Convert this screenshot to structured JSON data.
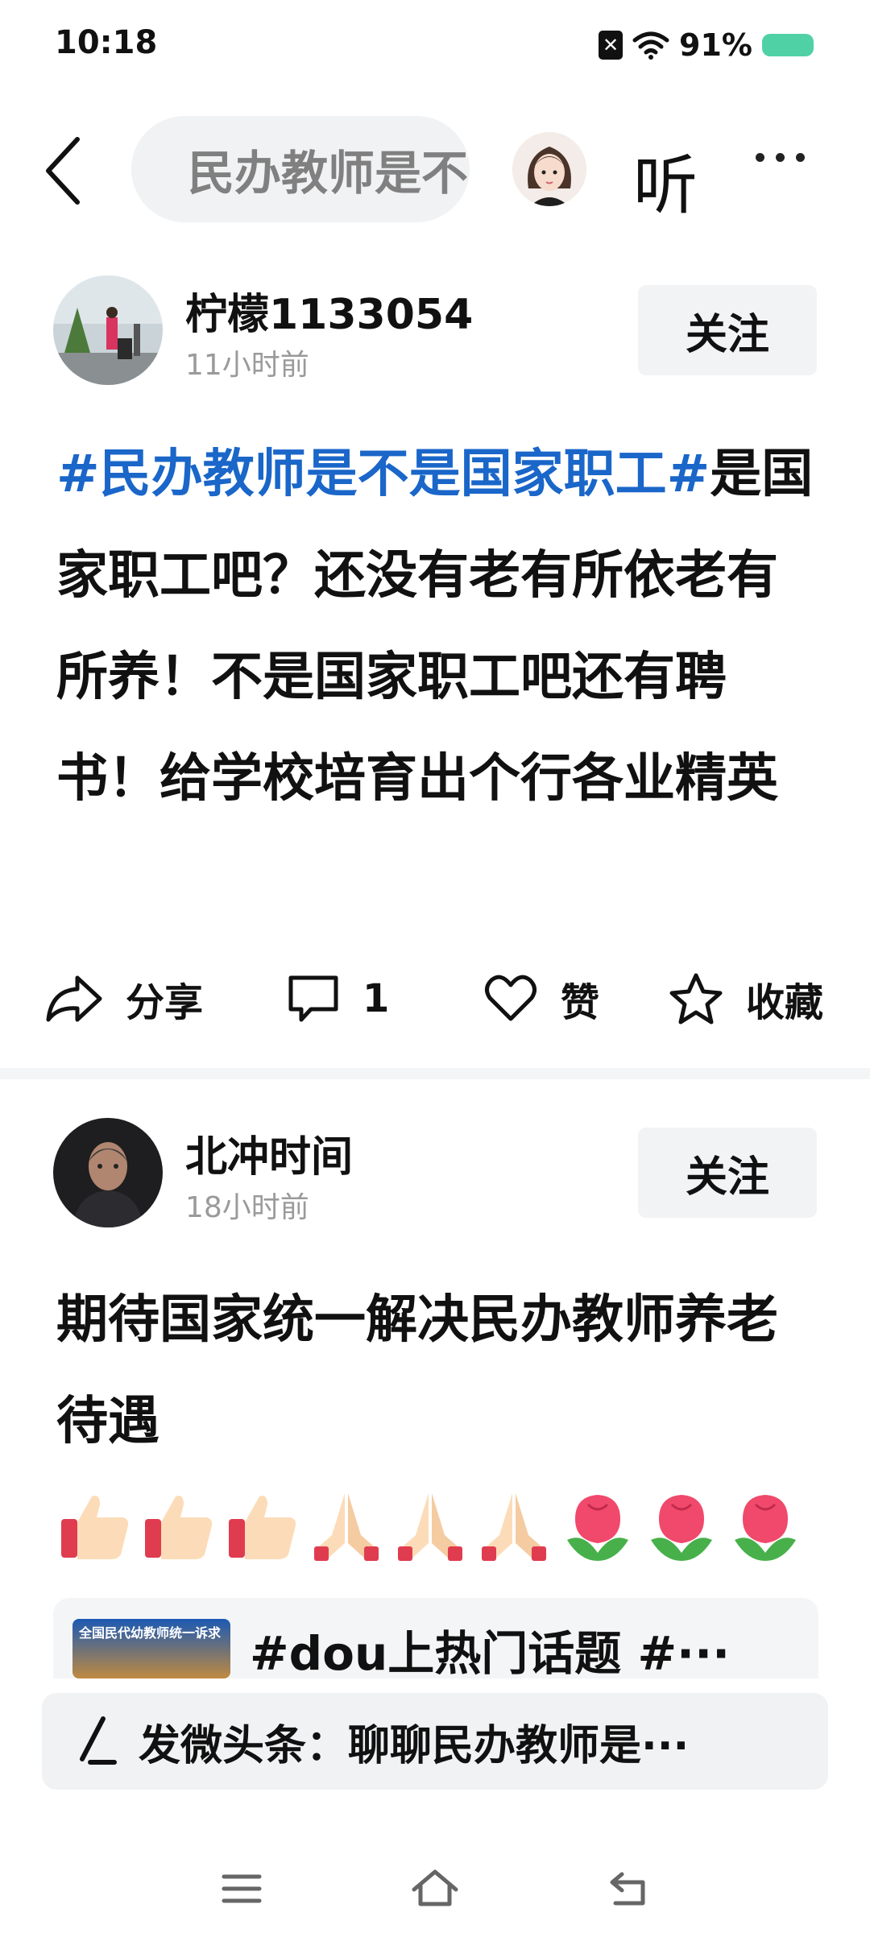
{
  "status_bar": {
    "time": "10:18",
    "battery_pct": "91%"
  },
  "header": {
    "search_text": "民办教师是不是国家职工",
    "listen_label": "听"
  },
  "posts": [
    {
      "username": "柠檬1133054",
      "timestamp": "11小时前",
      "follow_label": "关注",
      "hashtag": "#民办教师是不是国家职工#",
      "body": "是国家职工吧？还没有老有所依老有所养！不是国家职工吧还有聘书！给学校培育出个行各业精英",
      "actions": {
        "share_label": "分享",
        "comment_count": "1",
        "like_label": "赞",
        "favorite_label": "收藏"
      }
    },
    {
      "username": "北冲时间",
      "timestamp": "18小时前",
      "follow_label": "关注",
      "body": "期待国家统一解决民办教师养老待遇",
      "emojis": [
        "thumbs-up",
        "thumbs-up",
        "thumbs-up",
        "folded-hands",
        "folded-hands",
        "folded-hands",
        "rose",
        "rose",
        "rose"
      ],
      "link_card": {
        "thumb_text": "全国民代幼教师统一诉求",
        "text": "#dou上热门话题 #···"
      }
    }
  ],
  "compose": {
    "text": "发微头条：聊聊民办教师是···"
  },
  "colors": {
    "hashtag": "#1a66c9",
    "battery": "#4fd1a5"
  }
}
